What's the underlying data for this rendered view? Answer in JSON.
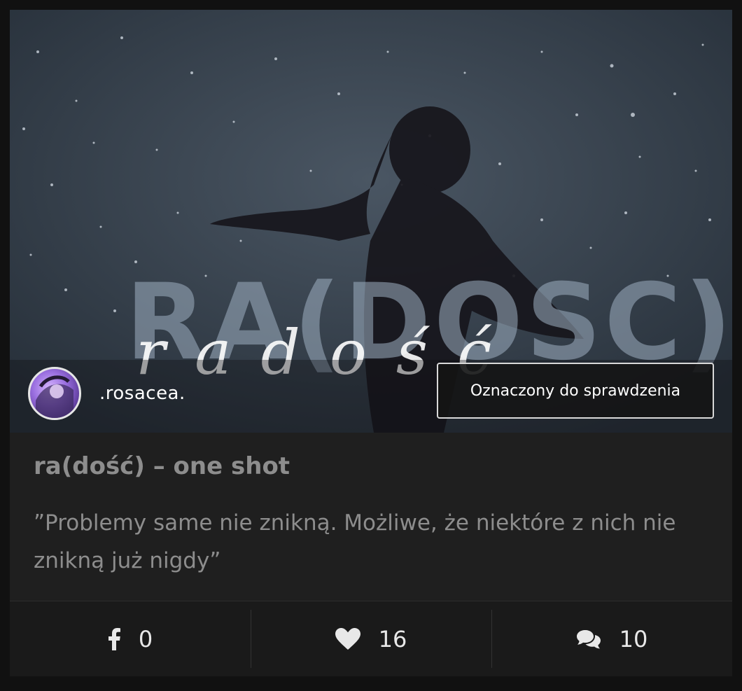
{
  "story": {
    "author_name": ".rosacea.",
    "status_badge": "Oznaczony do sprawdzenia",
    "title": "ra(dość) – one shot",
    "description": "”Problemy same nie znikną. Możliwe, że niektóre z nich nie znikną już nigdy”",
    "cover_text": "RA(DOŚĆ)",
    "cover_script": "radość"
  },
  "stats": {
    "facebook_icon": "facebook-icon",
    "facebook_count": "0",
    "like_icon": "heart-icon",
    "like_count": "16",
    "comment_icon": "comments-icon",
    "comment_count": "10"
  },
  "colors": {
    "page_background": "#111111",
    "card_background": "#1f1f1f",
    "text_muted": "#8d8d8d",
    "text_light": "#e8e8e8"
  }
}
